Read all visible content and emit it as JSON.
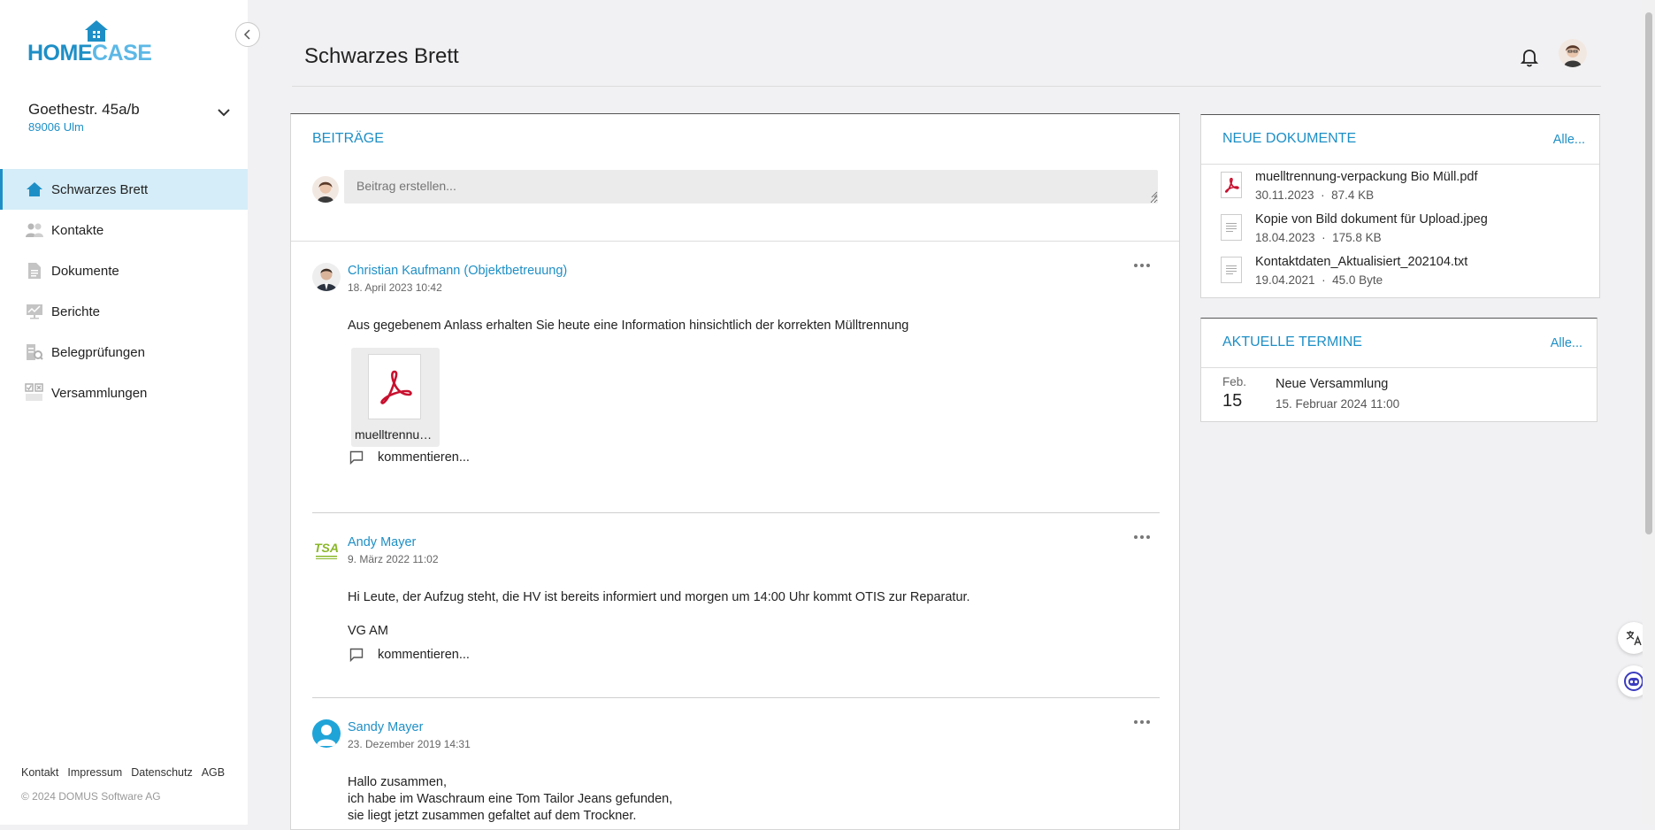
{
  "brand": {
    "logo_prefix": "HOME",
    "logo_suffix": "CASE"
  },
  "property": {
    "name": "Goethestr. 45a/b",
    "city": "89006 Ulm"
  },
  "sidebar": {
    "items": [
      {
        "label": "Schwarzes Brett",
        "icon": "home-icon",
        "active": true
      },
      {
        "label": "Kontakte",
        "icon": "contacts-icon"
      },
      {
        "label": "Dokumente",
        "icon": "document-icon"
      },
      {
        "label": "Berichte",
        "icon": "report-icon"
      },
      {
        "label": "Belegprüfungen",
        "icon": "receipt-check-icon"
      },
      {
        "label": "Versammlungen",
        "icon": "assembly-icon"
      }
    ],
    "footer_links": [
      "Kontakt",
      "Impressum",
      "Datenschutz",
      "AGB"
    ],
    "copyright": "© 2024 DOMUS Software AG"
  },
  "header": {
    "title": "Schwarzes Brett"
  },
  "posts": {
    "title": "BEITRÄGE",
    "composer_placeholder": "Beitrag erstellen...",
    "comment_label": "kommentieren...",
    "items": [
      {
        "author": "Christian Kaufmann (Objektbetreuung)",
        "date": "18. April 2023 10:42",
        "lines": [
          "Aus gegebenem Anlass erhalten Sie heute eine Information hinsichtlich der korrekten Mülltrennung"
        ],
        "attachment": "muelltrennung-verpackung Bio Müll.pdf"
      },
      {
        "author": "Andy Mayer",
        "date": "9. März 2022 11:02",
        "lines": [
          "Hi Leute, der Aufzug steht, die HV ist bereits informiert und morgen um 14:00 Uhr kommt OTIS zur Reparatur.",
          "VG AM"
        ]
      },
      {
        "author": "Sandy Mayer",
        "date": "23. Dezember 2019 14:31",
        "lines": [
          "Hallo zusammen,",
          "ich habe im Waschraum eine Tom Tailor Jeans gefunden,",
          "sie liegt jetzt zusammen gefaltet auf dem Trockner."
        ]
      }
    ]
  },
  "documents": {
    "title": "NEUE DOKUMENTE",
    "all_label": "Alle...",
    "items": [
      {
        "name": "muelltrennung-verpackung Bio Müll.pdf",
        "date": "30.11.2023",
        "size": "87.4 KB",
        "type": "pdf"
      },
      {
        "name": "Kopie von Bild dokument für Upload.jpeg",
        "date": "18.04.2023",
        "size": "175.8 KB",
        "type": "file"
      },
      {
        "name": "Kontaktdaten_Aktualisiert_202104.txt",
        "date": "19.04.2021",
        "size": "45.0 Byte",
        "type": "file"
      }
    ]
  },
  "events": {
    "title": "AKTUELLE TERMINE",
    "all_label": "Alle...",
    "items": [
      {
        "month": "Feb.",
        "day": "15",
        "title": "Neue Versammlung",
        "date": "15. Februar 2024 11:00"
      }
    ]
  },
  "colors": {
    "accent": "#1e8fc6",
    "active_bg": "#d5edf8",
    "pdf_red": "#c8102e",
    "logo_lime": "#8ab72a"
  }
}
